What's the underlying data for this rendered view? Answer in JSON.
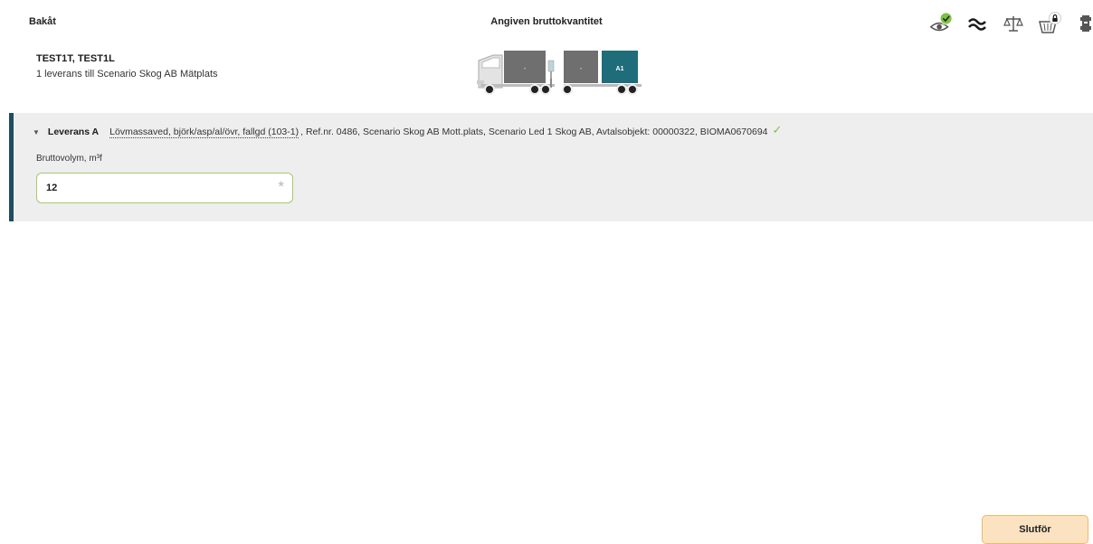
{
  "header": {
    "back_label": "Bakåt",
    "title": "Angiven bruttokvantitet"
  },
  "toolbar": {
    "icons": [
      "eye-check-icon",
      "approx-icon",
      "scale-icon",
      "basket-lock-icon",
      "vehicle-top-icon"
    ],
    "check_color": "#7cc242"
  },
  "vehicle": {
    "ids": "TEST1T, TEST1L",
    "summary": "1 leverans till Scenario Skog AB Mätplats",
    "compartments": [
      {
        "label": "-",
        "color": "#6f6f6f"
      },
      {
        "label": "-",
        "color": "#6f6f6f"
      },
      {
        "label": "A1",
        "color": "#1f6d7a"
      }
    ]
  },
  "delivery": {
    "title": "Leverans A",
    "assortment": "Lövmassaved, björk/asp/al/övr, fallgd (103-1)",
    "details": ", Ref.nr. 0486, Scenario Skog AB Mott.plats, Scenario Led 1 Skog AB, Avtalsobjekt: 00000322, BIOMA0670694",
    "field_label": "Bruttovolym, m³f",
    "field_value": "12",
    "required_mark": "*"
  },
  "actions": {
    "finish_label": "Slutför"
  },
  "colors": {
    "accent": "#1f4e5f",
    "panel_bg": "#eeeeee",
    "finish_bg": "#fbe3c2",
    "finish_border": "#f0b764",
    "field_border": "#a8c86d"
  }
}
